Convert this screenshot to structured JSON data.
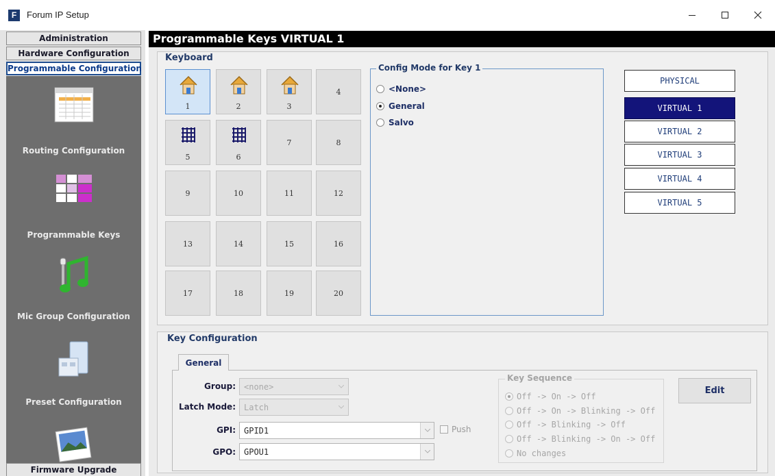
{
  "window": {
    "title": "Forum IP Setup",
    "icon_letter": "F",
    "controls": [
      "minimize-icon",
      "maximize-icon",
      "close-icon"
    ]
  },
  "nav": {
    "headers": [
      {
        "label": "Administration"
      },
      {
        "label": "Hardware Configuration"
      },
      {
        "label": "Programmable Configuration"
      }
    ],
    "items": [
      {
        "label": "Routing Configuration",
        "icon": "routing-grid-icon"
      },
      {
        "label": "Programmable Keys",
        "icon": "keys-grid-icon"
      },
      {
        "label": "Mic Group Configuration",
        "icon": "microphone-note-icon"
      },
      {
        "label": "Preset Configuration",
        "icon": "preset-folder-icon"
      },
      {
        "label": "",
        "icon": "firmware-photo-icon"
      }
    ],
    "footer": "Firmware Upgrade"
  },
  "main": {
    "title": "Programmable Keys VIRTUAL  1",
    "keyboard": {
      "title": "Keyboard",
      "selected_key": "1",
      "keys": [
        {
          "label": "1",
          "icon": "house-icon"
        },
        {
          "label": "2",
          "icon": "house-icon"
        },
        {
          "label": "3",
          "icon": "house-icon"
        },
        {
          "label": "4",
          "icon": ""
        },
        {
          "label": "5",
          "icon": "grid-icon"
        },
        {
          "label": "6",
          "icon": "grid-icon"
        },
        {
          "label": "7",
          "icon": ""
        },
        {
          "label": "8",
          "icon": ""
        },
        {
          "label": "9",
          "icon": ""
        },
        {
          "label": "10",
          "icon": ""
        },
        {
          "label": "11",
          "icon": ""
        },
        {
          "label": "12",
          "icon": ""
        },
        {
          "label": "13",
          "icon": ""
        },
        {
          "label": "14",
          "icon": ""
        },
        {
          "label": "15",
          "icon": ""
        },
        {
          "label": "16",
          "icon": ""
        },
        {
          "label": "17",
          "icon": ""
        },
        {
          "label": "18",
          "icon": ""
        },
        {
          "label": "19",
          "icon": ""
        },
        {
          "label": "20",
          "icon": ""
        }
      ]
    },
    "config_mode": {
      "title": "Config Mode for Key 1",
      "options": [
        {
          "label": "<None>",
          "selected": false
        },
        {
          "label": "General",
          "selected": true
        },
        {
          "label": "Salvo",
          "selected": false
        }
      ]
    },
    "panels": {
      "active": "VIRTUAL  1",
      "buttons": [
        "PHYSICAL",
        "VIRTUAL  1",
        "VIRTUAL  2",
        "VIRTUAL  3",
        "VIRTUAL  4",
        "VIRTUAL  5"
      ]
    },
    "key_configuration": {
      "title": "Key Configuration",
      "tab": "General",
      "group": {
        "label": "Group:",
        "value": "<none>",
        "enabled": false
      },
      "latch": {
        "label": "Latch Mode:",
        "value": "Latch",
        "enabled": false
      },
      "gpi": {
        "label": "GPI:",
        "value": "GPID1",
        "enabled": true
      },
      "gpo": {
        "label": "GPO:",
        "value": "GPOU1",
        "enabled": true
      },
      "push": {
        "label": "Push",
        "checked": false,
        "enabled": false
      },
      "key_sequence": {
        "title": "Key Sequence",
        "enabled": false,
        "options": [
          {
            "label": "Off -> On -> Off",
            "selected": true
          },
          {
            "label": "Off -> On -> Blinking -> Off",
            "selected": false
          },
          {
            "label": "Off -> Blinking -> Off",
            "selected": false
          },
          {
            "label": "Off -> Blinking -> On -> Off",
            "selected": false
          },
          {
            "label": "No changes",
            "selected": false
          }
        ]
      },
      "edit_label": "Edit"
    }
  },
  "colors": {
    "title_bar": "#000000",
    "nav_panel": "#6e6e6e",
    "nav_active_border": "#1e4d8f",
    "panel_active": "#13147a",
    "key_selected": "#d3e5f7",
    "label_text": "#1e2f66"
  }
}
